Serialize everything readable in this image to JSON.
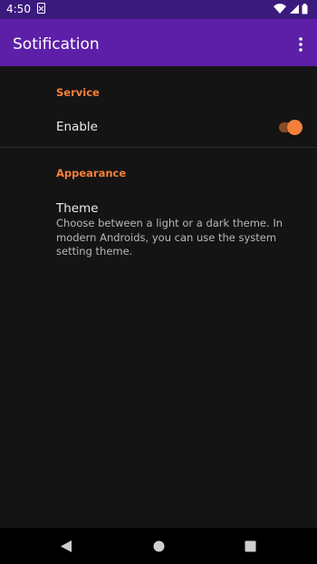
{
  "status_bar": {
    "time": "4:50",
    "icons": [
      "notification-icon",
      "wifi-icon",
      "signal-icon",
      "battery-icon"
    ]
  },
  "app_bar": {
    "title": "Sotification",
    "overflow_icon": "more-vert-icon"
  },
  "preferences": {
    "service": {
      "category_label": "Service",
      "enable": {
        "title": "Enable",
        "checked": true
      }
    },
    "appearance": {
      "category_label": "Appearance",
      "theme": {
        "title": "Theme",
        "summary": "Choose between a light or a dark theme. In modern Androids, you can use the system setting theme."
      }
    }
  },
  "nav_bar": {
    "icons": [
      "back-icon",
      "home-icon",
      "recents-icon"
    ]
  },
  "colors": {
    "status_bar": "#3b1a7e",
    "app_bar": "#5d1fa8",
    "accent": "#f5803b",
    "background": "#141414"
  }
}
